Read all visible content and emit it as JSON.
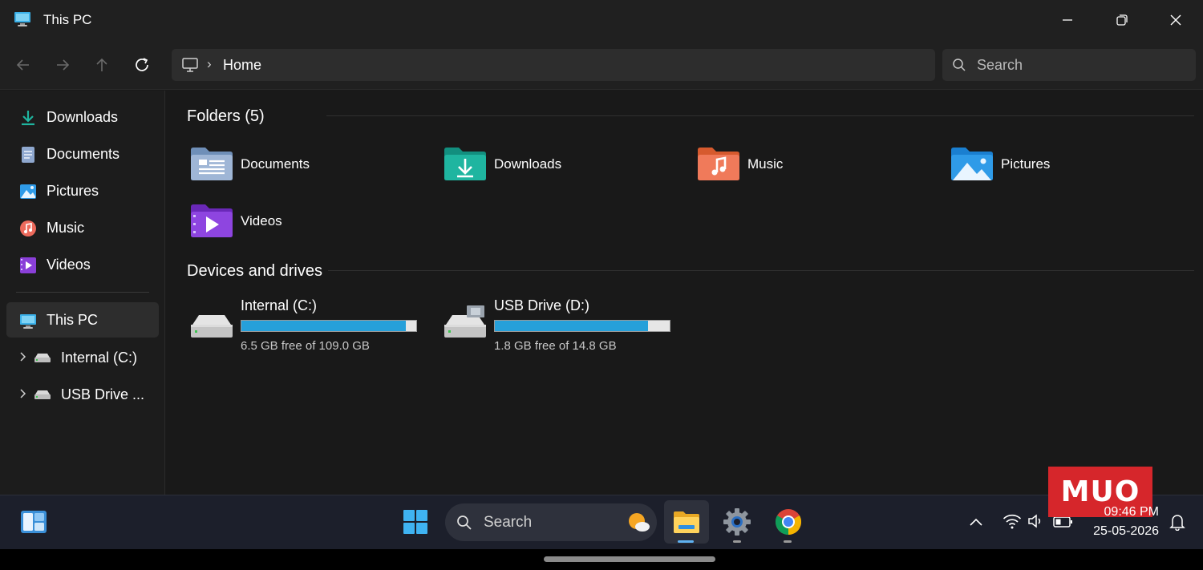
{
  "window": {
    "title": "This PC",
    "controls": [
      "minimize",
      "restore",
      "close"
    ]
  },
  "navigation": {
    "buttons": [
      "back",
      "forward",
      "up",
      "refresh"
    ],
    "breadcrumb_separator": "›",
    "breadcrumb": "Home",
    "search_placeholder": "Search"
  },
  "sidebar": {
    "items": [
      {
        "label": "Downloads",
        "icon": "download-icon"
      },
      {
        "label": "Documents",
        "icon": "documents-icon"
      },
      {
        "label": "Pictures",
        "icon": "pictures-icon"
      },
      {
        "label": "Music",
        "icon": "music-icon"
      },
      {
        "label": "Videos",
        "icon": "videos-icon"
      }
    ],
    "this_pc": {
      "label": "This PC",
      "icon": "this-pc-icon"
    },
    "drives": [
      {
        "label": "Internal (C:)",
        "icon": "drive-icon"
      },
      {
        "label": "USB Drive ...",
        "icon": "drive-icon"
      }
    ]
  },
  "folders": {
    "header": "Folders (5)",
    "items": [
      {
        "label": "Documents",
        "icon": "documents-folder-icon",
        "color": "#8fa8c8"
      },
      {
        "label": "Downloads",
        "icon": "downloads-folder-icon",
        "color": "#1fb5a0"
      },
      {
        "label": "Music",
        "icon": "music-folder-icon",
        "color": "#f07a4a"
      },
      {
        "label": "Pictures",
        "icon": "pictures-folder-icon",
        "color": "#2f9be8"
      },
      {
        "label": "Videos",
        "icon": "videos-folder-icon",
        "color": "#8a3fd8"
      }
    ]
  },
  "drives": {
    "header": "Devices and drives",
    "items": [
      {
        "name": "Internal (C:)",
        "free_text": "6.5 GB free of 109.0 GB",
        "used_fraction": 0.94
      },
      {
        "name": "USB Drive (D:)",
        "free_text": "1.8 GB free of 14.8 GB",
        "used_fraction": 0.878
      }
    ]
  },
  "taskbar": {
    "search_placeholder": "Search",
    "apps": [
      "widgets-icon",
      "start-icon",
      "file-explorer-icon",
      "settings-icon",
      "chrome-icon"
    ],
    "tray": [
      "chevron-up-icon",
      "wifi-icon",
      "volume-icon",
      "battery-icon",
      "notification-icon"
    ],
    "time": "09:46 PM",
    "date": "25-05-2026"
  },
  "watermark": "MUO",
  "colors": {
    "accent": "#26a0da",
    "window_bg": "#191919",
    "taskbar_bg": "#1c1f2b"
  }
}
